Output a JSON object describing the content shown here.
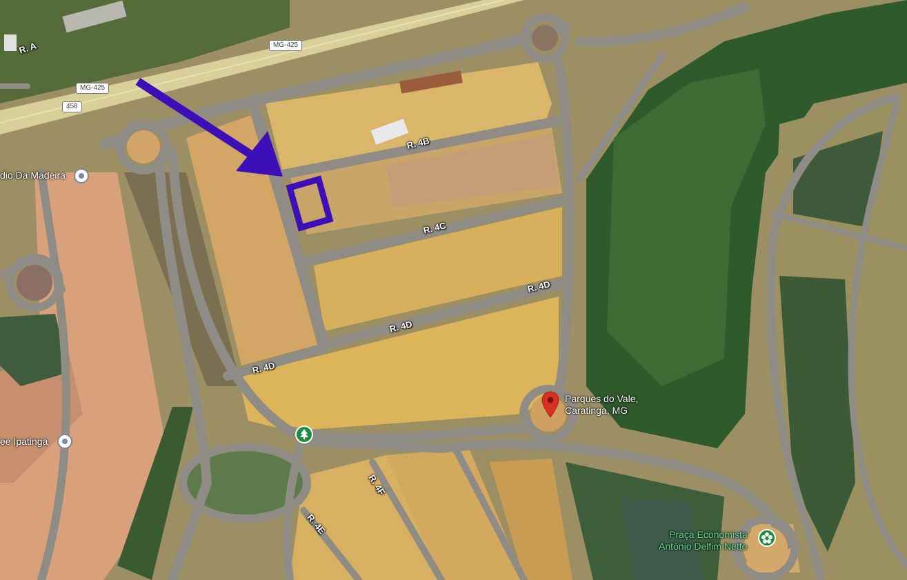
{
  "map": {
    "roads": {
      "rua_a": "R. A",
      "mg425_a": "MG-425",
      "mg425_b": "MG-425",
      "route_458": "458",
      "rua_4b": "R. 4B",
      "rua_4c": "R. 4C",
      "rua_4d_a": "R. 4D",
      "rua_4d_b": "R. 4D",
      "rua_4d_c": "R. 4D",
      "rua_4e": "R. 4E",
      "rua_4f": "R. 4F"
    },
    "places": {
      "left_top": "dio Da Madeira",
      "left_bottom": "ee Ipatinga",
      "marker_line1": "Parques do Vale,",
      "marker_line2": "Caratinga, MG",
      "praca_line1": "Praça Economista",
      "praca_line2": "Antônio Delfim Netto"
    },
    "annotation": {
      "color": "#3d0fb8"
    },
    "colors": {
      "marker": "#d93025",
      "park": "#1e8e3e"
    },
    "icons": [
      "location-pin-icon",
      "tree-icon",
      "flower-icon",
      "place-circle-icon",
      "arrow-icon",
      "highlight-box"
    ]
  }
}
